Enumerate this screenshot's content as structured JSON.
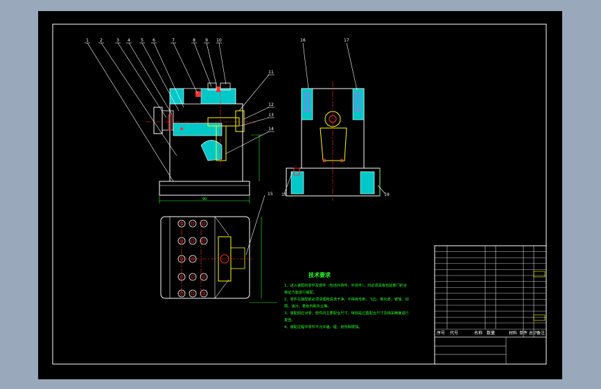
{
  "drawing": {
    "part_numbers_top_left": [
      "1",
      "2",
      "3",
      "4",
      "5",
      "6",
      "7",
      "8",
      "9",
      "10"
    ],
    "part_numbers_right": [
      "11",
      "12",
      "13",
      "14"
    ],
    "part_numbers_side_view": [
      "16",
      "17",
      "18",
      "19"
    ],
    "part_number_plan_view": "15",
    "dimension_base_width": "90"
  },
  "notes": {
    "title": "技术要求",
    "lines": [
      "1、进入装配的零件及部件（包括外购件、外协件），均必须具有检验部门的合",
      "格证方能进行装配。",
      "2、零件在装配前必须清理和清洗干净，不得有毛刺、飞边、氧化皮、锈蚀、切",
      "屑、油污、着色剂和灰尘等。",
      "3、装配前应对零、部件的主要配合尺寸，特别是过盈配合尺寸及相关精度进行",
      "复查。",
      "4、装配过程中零件不允许磕、碰、划伤和锈蚀。"
    ]
  },
  "title_block": {
    "footer_labels": [
      "序号",
      "代号",
      "名称",
      "数量",
      "材料",
      "单件 总计",
      "备注"
    ]
  },
  "colors": {
    "background": "#9aa8bb",
    "sheet": "#000000",
    "line_white": "#ffffff",
    "line_red": "#ff3030",
    "line_yellow": "#ffff00",
    "line_cyan": "#00ffff",
    "line_green": "#2bff2b",
    "fill_hatch": "#00c8c8",
    "line_magenta": "#ff40ff"
  }
}
